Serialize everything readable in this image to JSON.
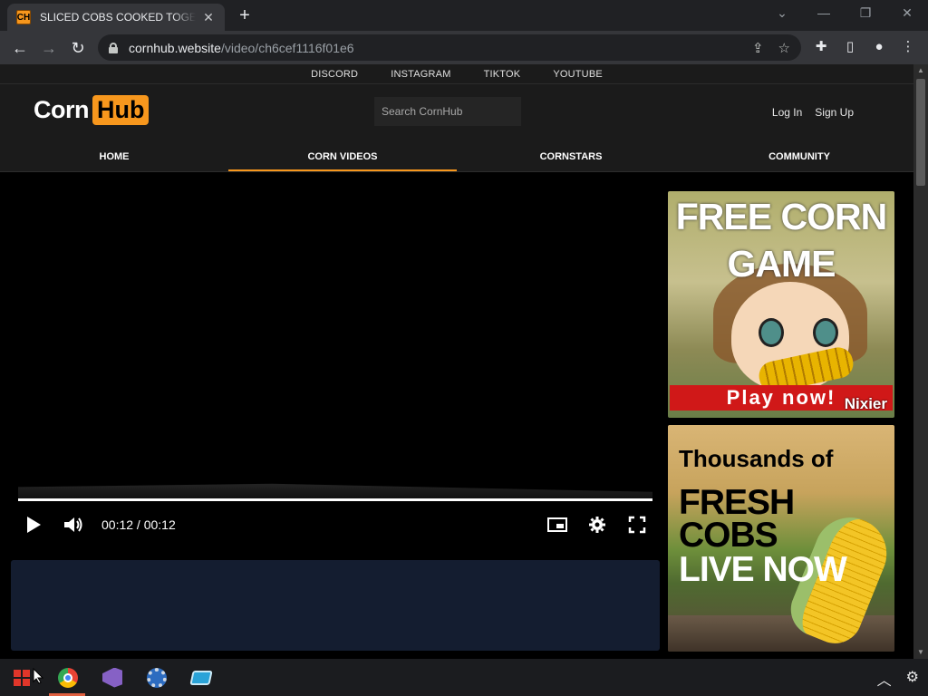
{
  "browser": {
    "tab": {
      "favicon_text": "CH",
      "title": "SLICED COBS COOKED TOGETHE",
      "close": "✕"
    },
    "new_tab": "+",
    "window_controls": {
      "dropdown": "⌄",
      "minimize": "—",
      "restore": "❐",
      "close": "✕"
    },
    "url": {
      "host": "cornhub.website",
      "path": "/video/ch6cef1116f01e6"
    }
  },
  "site": {
    "social_links": [
      "DISCORD",
      "INSTAGRAM",
      "TIKTOK",
      "YOUTUBE"
    ],
    "logo": {
      "part1": "Corn",
      "part2": "Hub"
    },
    "search_placeholder": "Search CornHub",
    "auth": {
      "login": "Log In",
      "signup": "Sign Up"
    },
    "nav": [
      {
        "label": "HOME",
        "active": false
      },
      {
        "label": "CORN VIDEOS",
        "active": true
      },
      {
        "label": "CORNSTARS",
        "active": false
      },
      {
        "label": "COMMUNITY",
        "active": false
      }
    ],
    "accent_color": "#f7971d"
  },
  "player": {
    "time": "00:12 / 00:12",
    "progress_percent": 100
  },
  "ads": {
    "ad1": {
      "title": "FREE CORN GAME",
      "cta": "Play now!",
      "brand": "Nixier"
    },
    "ad2": {
      "line1": "Thousands of",
      "line2": "FRESH COBS",
      "line3": "LIVE NOW"
    }
  },
  "taskbar": {
    "apps": [
      "windows-start",
      "chrome",
      "visual-studio",
      "settings",
      "tool"
    ],
    "tray": {
      "chevron": "︿",
      "gear": "⚙"
    }
  }
}
